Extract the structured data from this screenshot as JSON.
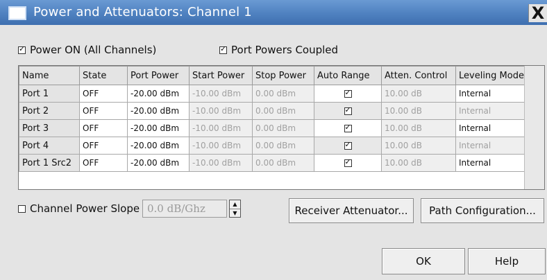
{
  "window": {
    "title": "Power and Attenuators: Channel 1",
    "close_label": "X"
  },
  "options": {
    "power_on": {
      "label": "Power ON (All Channels)",
      "checked": true
    },
    "port_powers_coupled": {
      "label": "Port Powers Coupled",
      "checked": true
    }
  },
  "table": {
    "columns": [
      "Name",
      "State",
      "Port Power",
      "Start Power",
      "Stop Power",
      "Auto Range",
      "Atten. Control",
      "Leveling Mode"
    ],
    "rows": [
      {
        "name": "Port 1",
        "state": "OFF",
        "port_power": "-20.00 dBm",
        "start_power": "-10.00 dBm",
        "stop_power": "0.00 dBm",
        "auto_range": true,
        "atten_control": "10.00 dB",
        "leveling_mode": "Internal",
        "leveling_enabled": true
      },
      {
        "name": "Port 2",
        "state": "OFF",
        "port_power": "-20.00 dBm",
        "start_power": "-10.00 dBm",
        "stop_power": "0.00 dBm",
        "auto_range": true,
        "atten_control": "10.00 dB",
        "leveling_mode": "Internal",
        "leveling_enabled": false
      },
      {
        "name": "Port 3",
        "state": "OFF",
        "port_power": "-20.00 dBm",
        "start_power": "-10.00 dBm",
        "stop_power": "0.00 dBm",
        "auto_range": true,
        "atten_control": "10.00 dB",
        "leveling_mode": "Internal",
        "leveling_enabled": true
      },
      {
        "name": "Port 4",
        "state": "OFF",
        "port_power": "-20.00 dBm",
        "start_power": "-10.00 dBm",
        "stop_power": "0.00 dBm",
        "auto_range": true,
        "atten_control": "10.00 dB",
        "leveling_mode": "Internal",
        "leveling_enabled": false
      },
      {
        "name": "Port 1 Src2",
        "state": "OFF",
        "port_power": "-20.00 dBm",
        "start_power": "-10.00 dBm",
        "stop_power": "0.00 dBm",
        "auto_range": true,
        "atten_control": "10.00 dB",
        "leveling_mode": "Internal",
        "leveling_enabled": true
      }
    ]
  },
  "slope": {
    "label": "Channel Power Slope",
    "checked": false,
    "value": "0.0 dB/Ghz"
  },
  "buttons": {
    "receiver_attenuator": "Receiver Attenuator...",
    "path_configuration": "Path Configuration...",
    "ok": "OK",
    "help": "Help"
  },
  "colors": {
    "titlebar": "#4f81c0",
    "dialog_bg": "#e4e4e4",
    "disabled_text": "#a0a0a0"
  }
}
